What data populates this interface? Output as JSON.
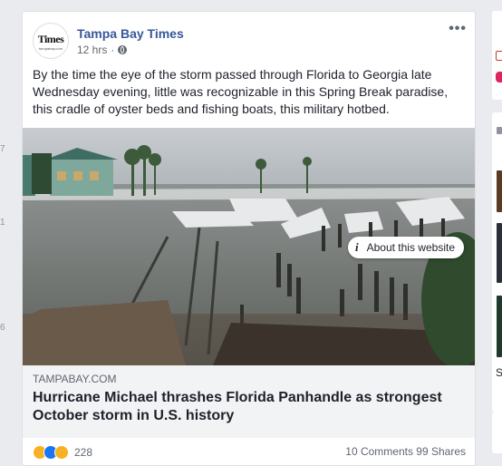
{
  "left_gutter": {
    "numbers": [
      "7",
      "1",
      "6"
    ]
  },
  "post": {
    "page_name": "Tampa Bay Times",
    "avatar": {
      "logo_text": "Times",
      "logo_subtext": "tampabay.com"
    },
    "timestamp": "12 hrs",
    "audience_icon": "globe-icon",
    "menu_icon": "more-options-icon",
    "menu_glyph": "•••",
    "text": "By the time the eye of the storm passed through Florida to Georgia late Wednesday evening, little was recognizable in this Spring Break paradise, this cradle of oyster beds and fishing boats, this military hotbed.",
    "about_pill": {
      "icon": "i",
      "label": "About this website"
    },
    "link": {
      "domain": "TAMPABAY.COM",
      "headline": "Hurricane Michael thrashes Florida Panhandle as strongest October storm in U.S. history"
    },
    "footer": {
      "reaction_icons": [
        "haha-icon",
        "like-icon",
        "wow-icon"
      ],
      "reaction_count": "228",
      "comments_shares": "10 Comments  99 Shares"
    }
  },
  "right_column": {
    "partial_letter": "S"
  },
  "colors": {
    "link": "#365899",
    "background": "#e9ebee",
    "text": "#1d2129",
    "meta": "#616770"
  }
}
